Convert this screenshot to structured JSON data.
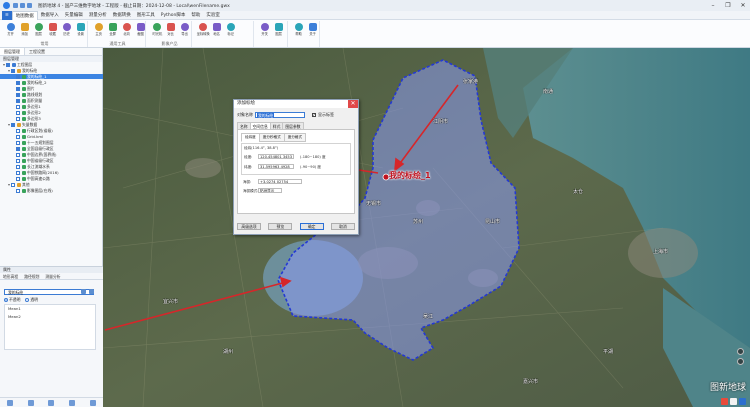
{
  "window": {
    "title": "图新地球 4 - 国产三维数字地球 - 工程版 - 截止日期：2024-12-08 - Local\\wenFilename.gwx",
    "controls": [
      "–",
      "❐",
      "✕"
    ]
  },
  "ribbon_tabs": [
    "",
    "地图数据",
    "数据导入",
    "矢量编辑",
    "测量分析",
    "数据转换",
    "图形工具",
    "Python脚本",
    "帮助",
    "实验室"
  ],
  "ribbon_active_tab": 1,
  "ribbon_groups": [
    {
      "name": "常用",
      "buttons": [
        "打开",
        "添加",
        "图层",
        "收藏",
        "历史",
        "设置"
      ]
    },
    {
      "name": "通用工具",
      "buttons": [
        "主页",
        "全屏",
        "北向",
        "截图"
      ]
    },
    {
      "name": "影像产品",
      "buttons": [
        "时光机",
        "对比",
        "导出"
      ]
    },
    {
      "name": "",
      "buttons": [
        "坐标转换",
        "地名",
        "标记"
      ]
    },
    {
      "name": "",
      "buttons": [
        "开关",
        "图层"
      ]
    },
    {
      "name": "",
      "buttons": [
        "帮助",
        "关于"
      ]
    }
  ],
  "left_panel": {
    "tabs": [
      "图层管理",
      "工程设置"
    ],
    "tree_header": "图层管理",
    "tree": [
      {
        "label": "工程图层",
        "level": 0,
        "checked": true,
        "expanded": true
      },
      {
        "label": "我的标绘",
        "level": 1,
        "checked": true,
        "expanded": true
      },
      {
        "label": "我的标绘_1",
        "level": 2,
        "checked": true,
        "selected": true
      },
      {
        "label": "我的标绘_2",
        "level": 2,
        "checked": true
      },
      {
        "label": "图片",
        "level": 2,
        "checked": true
      },
      {
        "label": "路线规划",
        "level": 2,
        "checked": true
      },
      {
        "label": "面积测量",
        "level": 2,
        "checked": true
      },
      {
        "label": "多边形1",
        "level": 2,
        "checked": false
      },
      {
        "label": "多边形2",
        "level": 2,
        "checked": false
      },
      {
        "label": "多边形3",
        "level": 2,
        "checked": false
      },
      {
        "label": "矢量数据",
        "level": 1,
        "checked": true,
        "expanded": true
      },
      {
        "label": "行政区划(省级)",
        "level": 2,
        "checked": false
      },
      {
        "label": "Grid.kml",
        "level": 2,
        "checked": false
      },
      {
        "label": "十一五规划图层",
        "level": 2,
        "checked": false
      },
      {
        "label": "全国县级行政区",
        "level": 2,
        "checked": true
      },
      {
        "label": "中国边界(国界线)",
        "level": 2,
        "checked": false
      },
      {
        "label": "中国省级行政区",
        "level": 2,
        "checked": false
      },
      {
        "label": "长江流域水系",
        "level": 2,
        "checked": false
      },
      {
        "label": "中国铁路网(2016)",
        "level": 2,
        "checked": false
      },
      {
        "label": "中国高速公路",
        "level": 2,
        "checked": false
      },
      {
        "label": "其他",
        "level": 1,
        "checked": false,
        "expanded": true
      },
      {
        "label": "影像图层(在线)",
        "level": 2,
        "checked": false
      }
    ],
    "props": {
      "header": "属性",
      "tabs": [
        "地形高程",
        "路径规划",
        "测量分析"
      ],
      "selected": "我的标绘",
      "radio": [
        "不透明",
        "透明"
      ],
      "list": [
        "Mean1",
        "Mean2"
      ]
    }
  },
  "map": {
    "cities": [
      "常州",
      "无锡市",
      "苏州",
      "昆山市",
      "上海市",
      "湖州",
      "嘉兴市",
      "宜兴市",
      "江阴市",
      "张家港",
      "太仓",
      "南通",
      "吴江",
      "平湖"
    ],
    "marker_label": "我的标绘_1",
    "watermark": "图新地球",
    "accent_color": "#2c6fcf",
    "arrow_color": "#d6262a"
  },
  "dialog": {
    "title": "添加标绘",
    "name_label": "对象名称",
    "name_value": "我的标绘",
    "show_label_text": "显示标签",
    "tabs": [
      "名称",
      "空间信息",
      "样式",
      "图层参数"
    ],
    "active_tab": 1,
    "subtabs": [
      "经纬度",
      "度分秒格式",
      "度分格式"
    ],
    "coord_header": "经纬(116.4°, 38.8°)",
    "lon_label": "经度:",
    "lon_value": "120.454801 3453",
    "lon_range": "(-180~180) 度",
    "lat_label": "纬度:",
    "lat_value": "31.595963 4928",
    "lat_range": "(-90~90) 度",
    "alt_label": "海拔:",
    "alt_value": "+3.0274 02754",
    "mode_label": "海拔模式:",
    "mode_value": "贴地显示",
    "buttons": [
      "高级选项",
      "预览",
      "确定",
      "取消"
    ]
  }
}
